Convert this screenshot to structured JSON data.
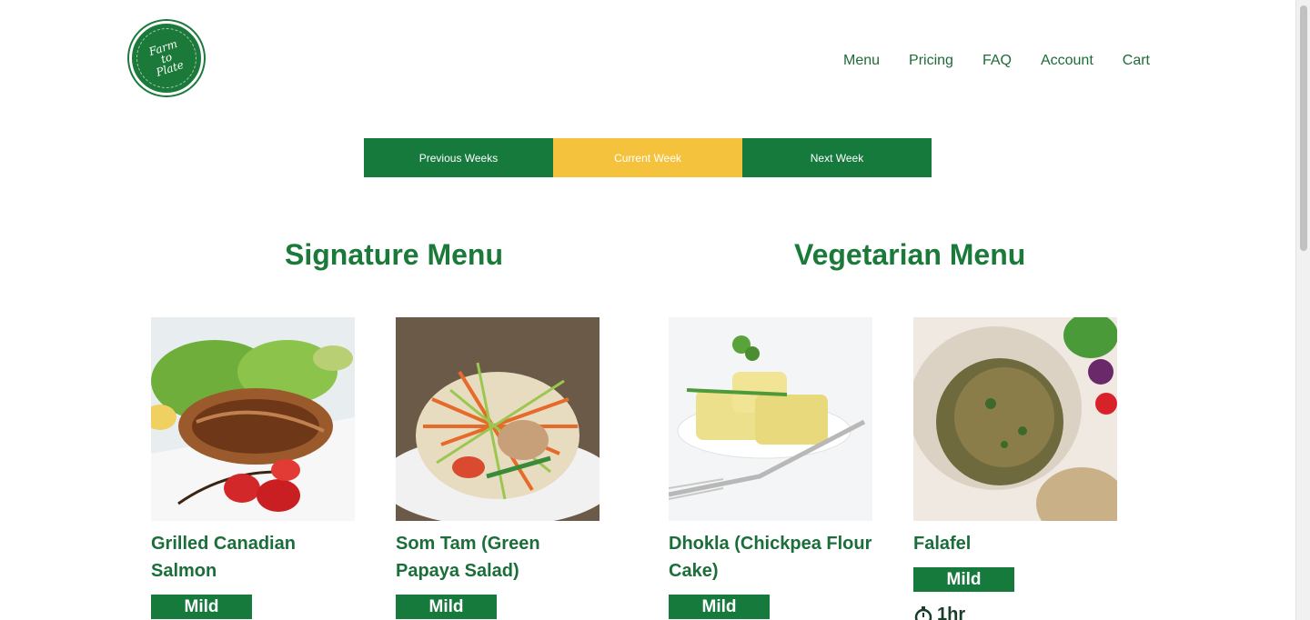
{
  "brand": {
    "logo_line1": "Farm",
    "logo_line2": "to",
    "logo_line3": "Plate"
  },
  "nav": [
    "Menu",
    "Pricing",
    "FAQ",
    "Account",
    "Cart"
  ],
  "weeks": {
    "tabs": [
      "Previous Weeks",
      "Current Week",
      "Next Week"
    ],
    "active": "Current Week"
  },
  "sections": {
    "signature_title": "Signature Menu",
    "vegetarian_title": "Vegetarian Menu"
  },
  "dishes": [
    {
      "name": "Grilled Canadian Salmon",
      "spice": "Mild"
    },
    {
      "name": "Som Tam (Green Papaya Salad)",
      "spice": "Mild"
    },
    {
      "name": "Dhokla (Chickpea Flour Cake)",
      "spice": "Mild"
    },
    {
      "name": "Falafel",
      "spice": "Mild",
      "time": "1hr"
    }
  ],
  "colors": {
    "brand_green": "#177a3d",
    "accent_yellow": "#f4c23c"
  }
}
